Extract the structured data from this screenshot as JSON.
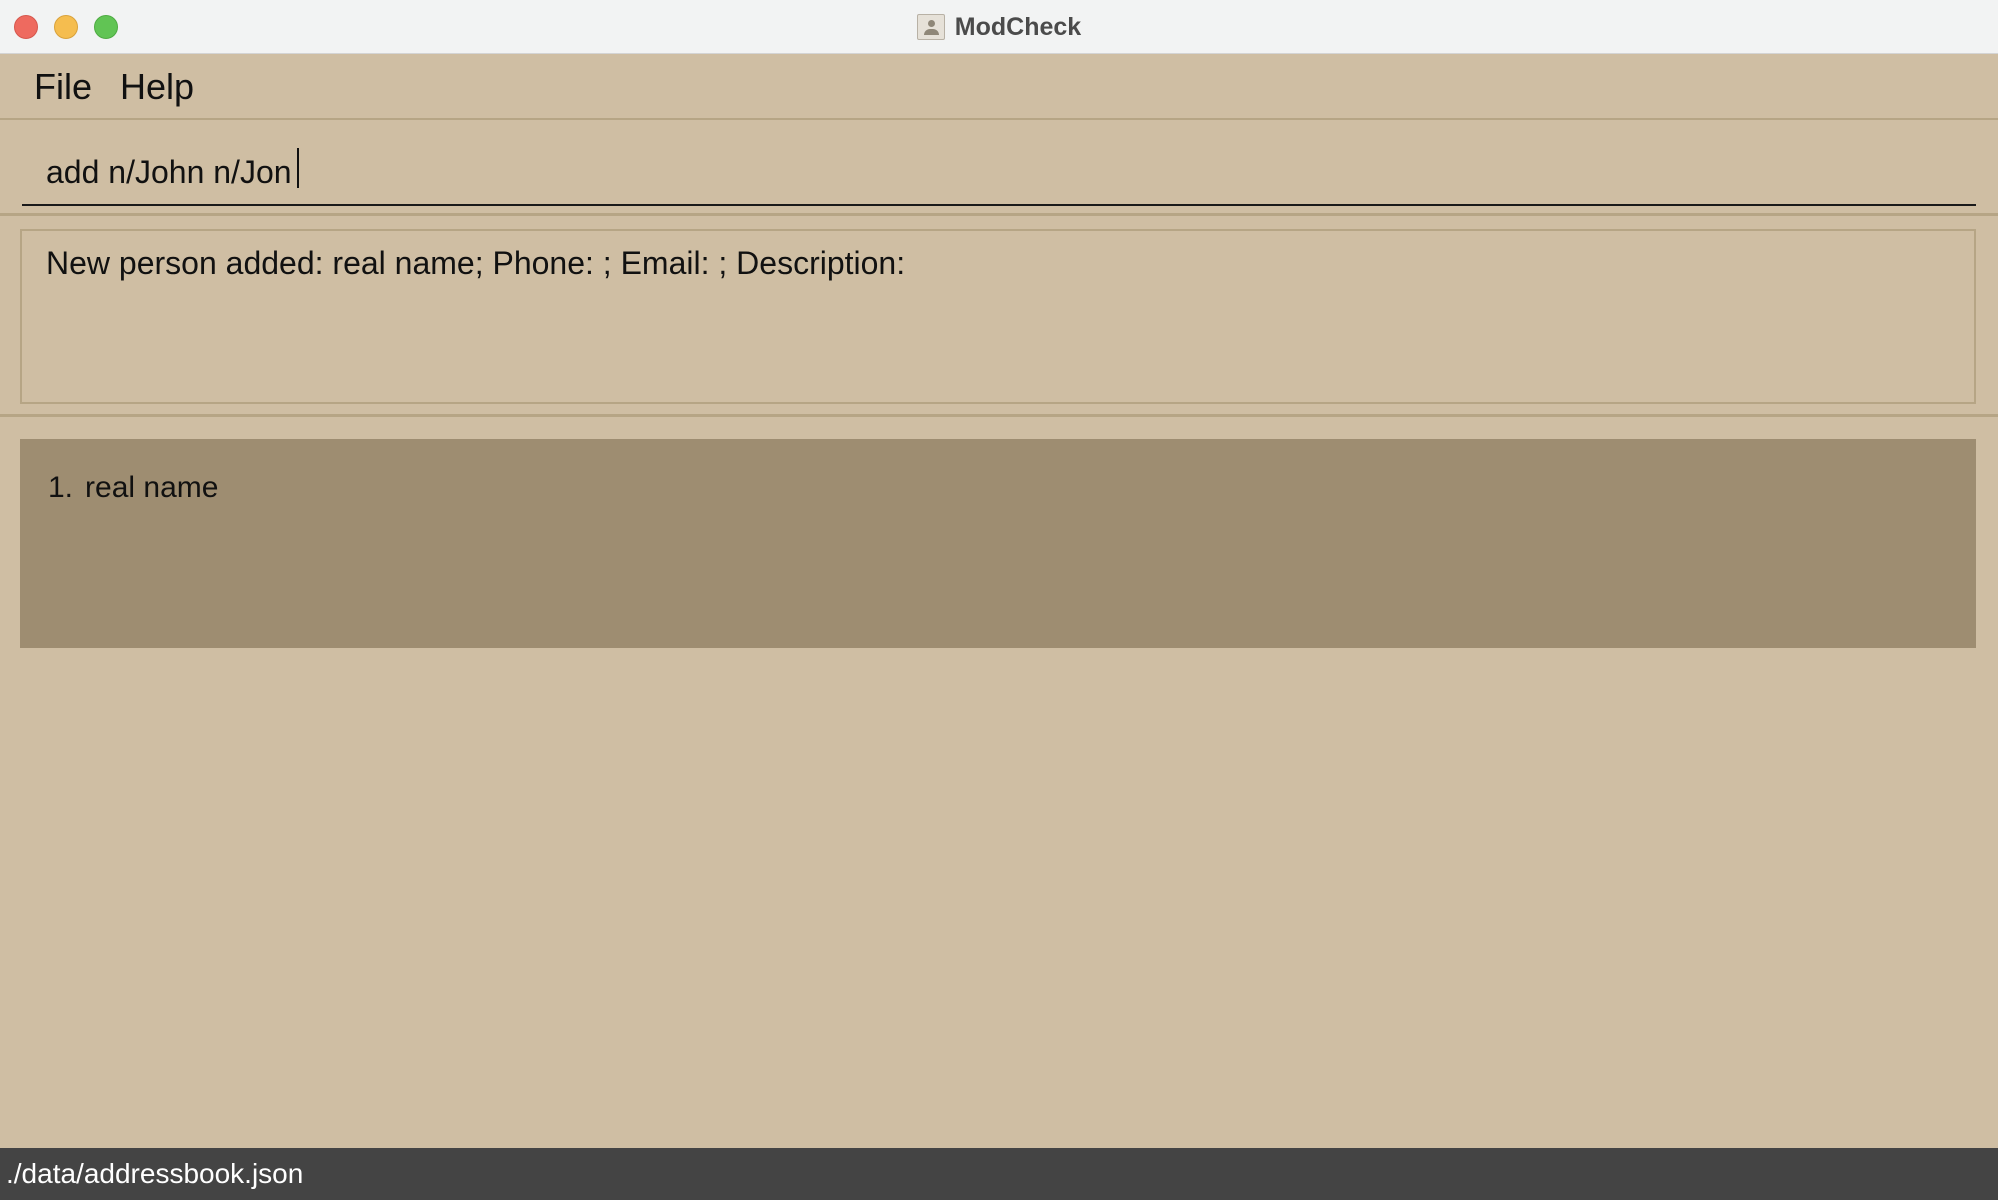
{
  "window": {
    "title": "ModCheck",
    "app_icon": "address-book-icon"
  },
  "menu": {
    "items": [
      {
        "label": "File"
      },
      {
        "label": "Help"
      }
    ]
  },
  "command": {
    "value": "add n/John n/Jon"
  },
  "result": {
    "message": "New person added: real name; Phone: ; Email: ; Description:"
  },
  "person_list": {
    "items": [
      {
        "index": "1.",
        "name": "real name"
      }
    ]
  },
  "status_bar": {
    "path": "./data/addressbook.json"
  },
  "colors": {
    "background": "#cfbea3",
    "card": "#9e8d71",
    "status_bar": "#444444"
  }
}
